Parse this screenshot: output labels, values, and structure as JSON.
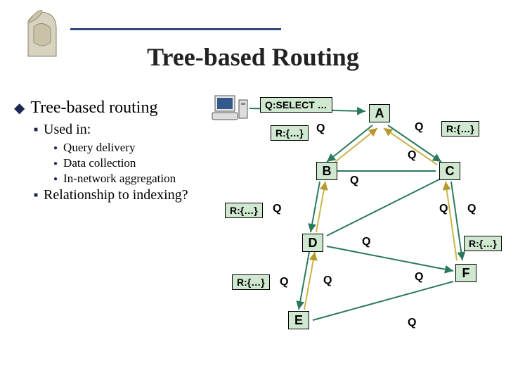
{
  "title": "Tree-based Routing",
  "bullets": {
    "l1": "Tree-based routing",
    "l2a": "Used in:",
    "l3a": "Query delivery",
    "l3b": "Data collection",
    "l3c": "In-network aggregation",
    "l2b": "Relationship to indexing?"
  },
  "diagram": {
    "query": "Q:SELECT …",
    "response": "R:{…}",
    "qlabel": "Q",
    "nodes": {
      "A": "A",
      "B": "B",
      "C": "C",
      "D": "D",
      "E": "E",
      "F": "F"
    }
  },
  "icons": {
    "logo": "athena-helmet-icon",
    "pc": "computer-icon"
  }
}
